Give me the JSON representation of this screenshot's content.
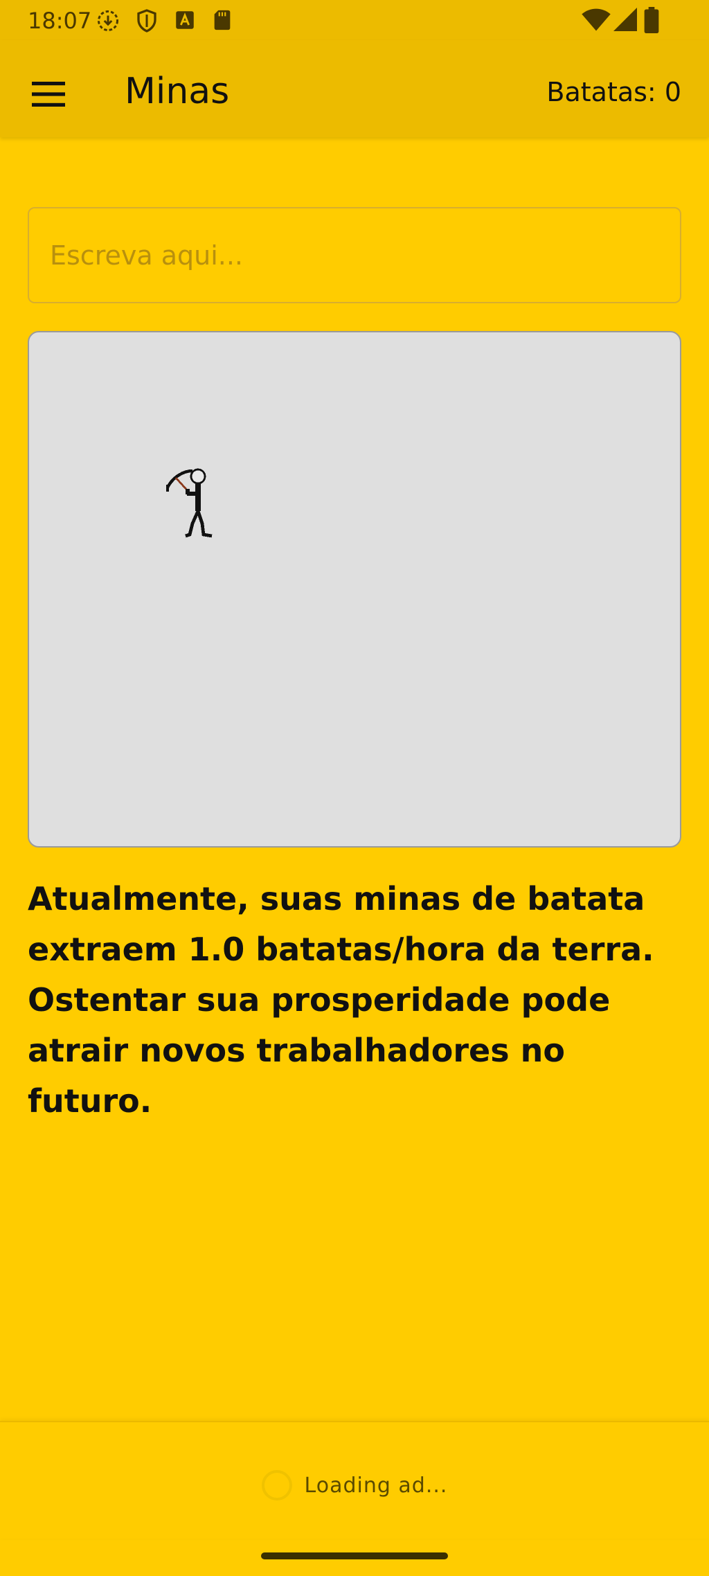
{
  "status_bar": {
    "time": "18:07",
    "left_icons": [
      "download-icon",
      "shield-icon",
      "font-icon",
      "sd-card-icon"
    ],
    "right_icons": [
      "wifi-icon",
      "signal-icon",
      "battery-icon"
    ]
  },
  "app_bar": {
    "menu_icon": "menu-icon",
    "title": "Minas",
    "counter": "Batatas: 0"
  },
  "input": {
    "value": "",
    "placeholder": "Escreva aqui..."
  },
  "canvas": {
    "sprite": "miner-with-pickaxe-icon"
  },
  "description": "Atualmente, suas minas de batata extraem 1.0 batatas/hora da terra. Ostentar sua prosperidade pode atrair novos trabalhadores no futuro.",
  "ad": {
    "text": "Loading ad..."
  },
  "colors": {
    "background": "#FFCC00",
    "app_bar": "#ECBB00",
    "canvas": "#DFDFDF"
  }
}
